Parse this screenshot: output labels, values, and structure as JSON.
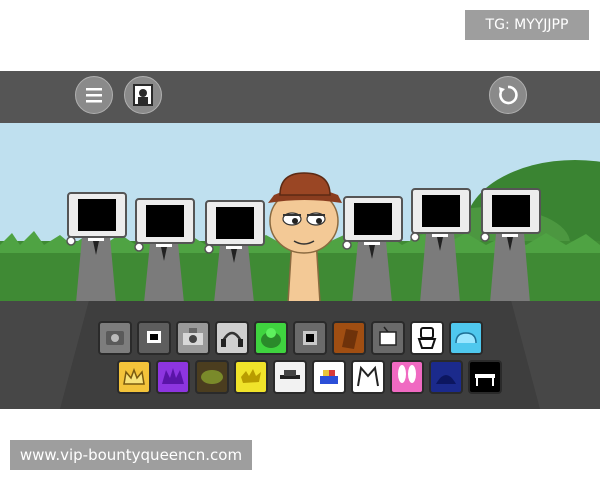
{
  "watermarks": {
    "top_right": "TG: MYYJJPP",
    "bottom_left": "www.vip-bountyqueencn.com"
  },
  "toolbar": {
    "menu_icon": "hamburger-menu-icon",
    "gallery_icon": "portrait-frame-icon",
    "reset_icon": "circular-arrow-icon"
  },
  "colors": {
    "toolbar_bg": "#555555",
    "sky": "#bfe0ef",
    "grass": "#3f8a34",
    "tray_bg": "#474747"
  },
  "stage": {
    "characters": [
      {
        "type": "monitor-head"
      },
      {
        "type": "monitor-head"
      },
      {
        "type": "monitor-head"
      },
      {
        "type": "hat-man"
      },
      {
        "type": "monitor-head"
      },
      {
        "type": "monitor-head"
      },
      {
        "type": "monitor-head"
      }
    ]
  },
  "tray": {
    "row1": [
      {
        "name": "camera-sound-icon",
        "color": "#7d7d7d"
      },
      {
        "name": "small-monitor-sound-icon",
        "color": "#5e5e5e"
      },
      {
        "name": "robot-camera-sound-icon",
        "color": "#9a9a9a"
      },
      {
        "name": "headphones-sound-icon",
        "color": "#cfcfcf"
      },
      {
        "name": "green-blob-sound-icon",
        "color": "#3fd43f"
      },
      {
        "name": "dark-screen-sound-icon",
        "color": "#6a6a6a"
      },
      {
        "name": "brown-card-sound-icon",
        "color": "#a04e12"
      },
      {
        "name": "tv-sound-icon",
        "color": "#6a6a6a"
      },
      {
        "name": "toilet-sound-icon",
        "color": "#ffffff"
      },
      {
        "name": "blue-cloud-sound-icon",
        "color": "#4fc8ee"
      }
    ],
    "row2": [
      {
        "name": "crown-sound-icon",
        "color": "#f3c33a"
      },
      {
        "name": "purple-spikes-sound-icon",
        "color": "#8d35e0"
      },
      {
        "name": "olive-bowl-sound-icon",
        "color": "#4b3d1f"
      },
      {
        "name": "yellow-splat-sound-icon",
        "color": "#f0e32a"
      },
      {
        "name": "hat-brim-sound-icon",
        "color": "#f2f2f2"
      },
      {
        "name": "rainbow-cap-sound-icon",
        "color": "#ffffff"
      },
      {
        "name": "cat-ears-sound-icon",
        "color": "#ffffff"
      },
      {
        "name": "pink-bunny-sound-icon",
        "color": "#f06ac2"
      },
      {
        "name": "navy-dome-sound-icon",
        "color": "#1b2a8c"
      },
      {
        "name": "black-bench-sound-icon",
        "color": "#000000"
      }
    ]
  }
}
